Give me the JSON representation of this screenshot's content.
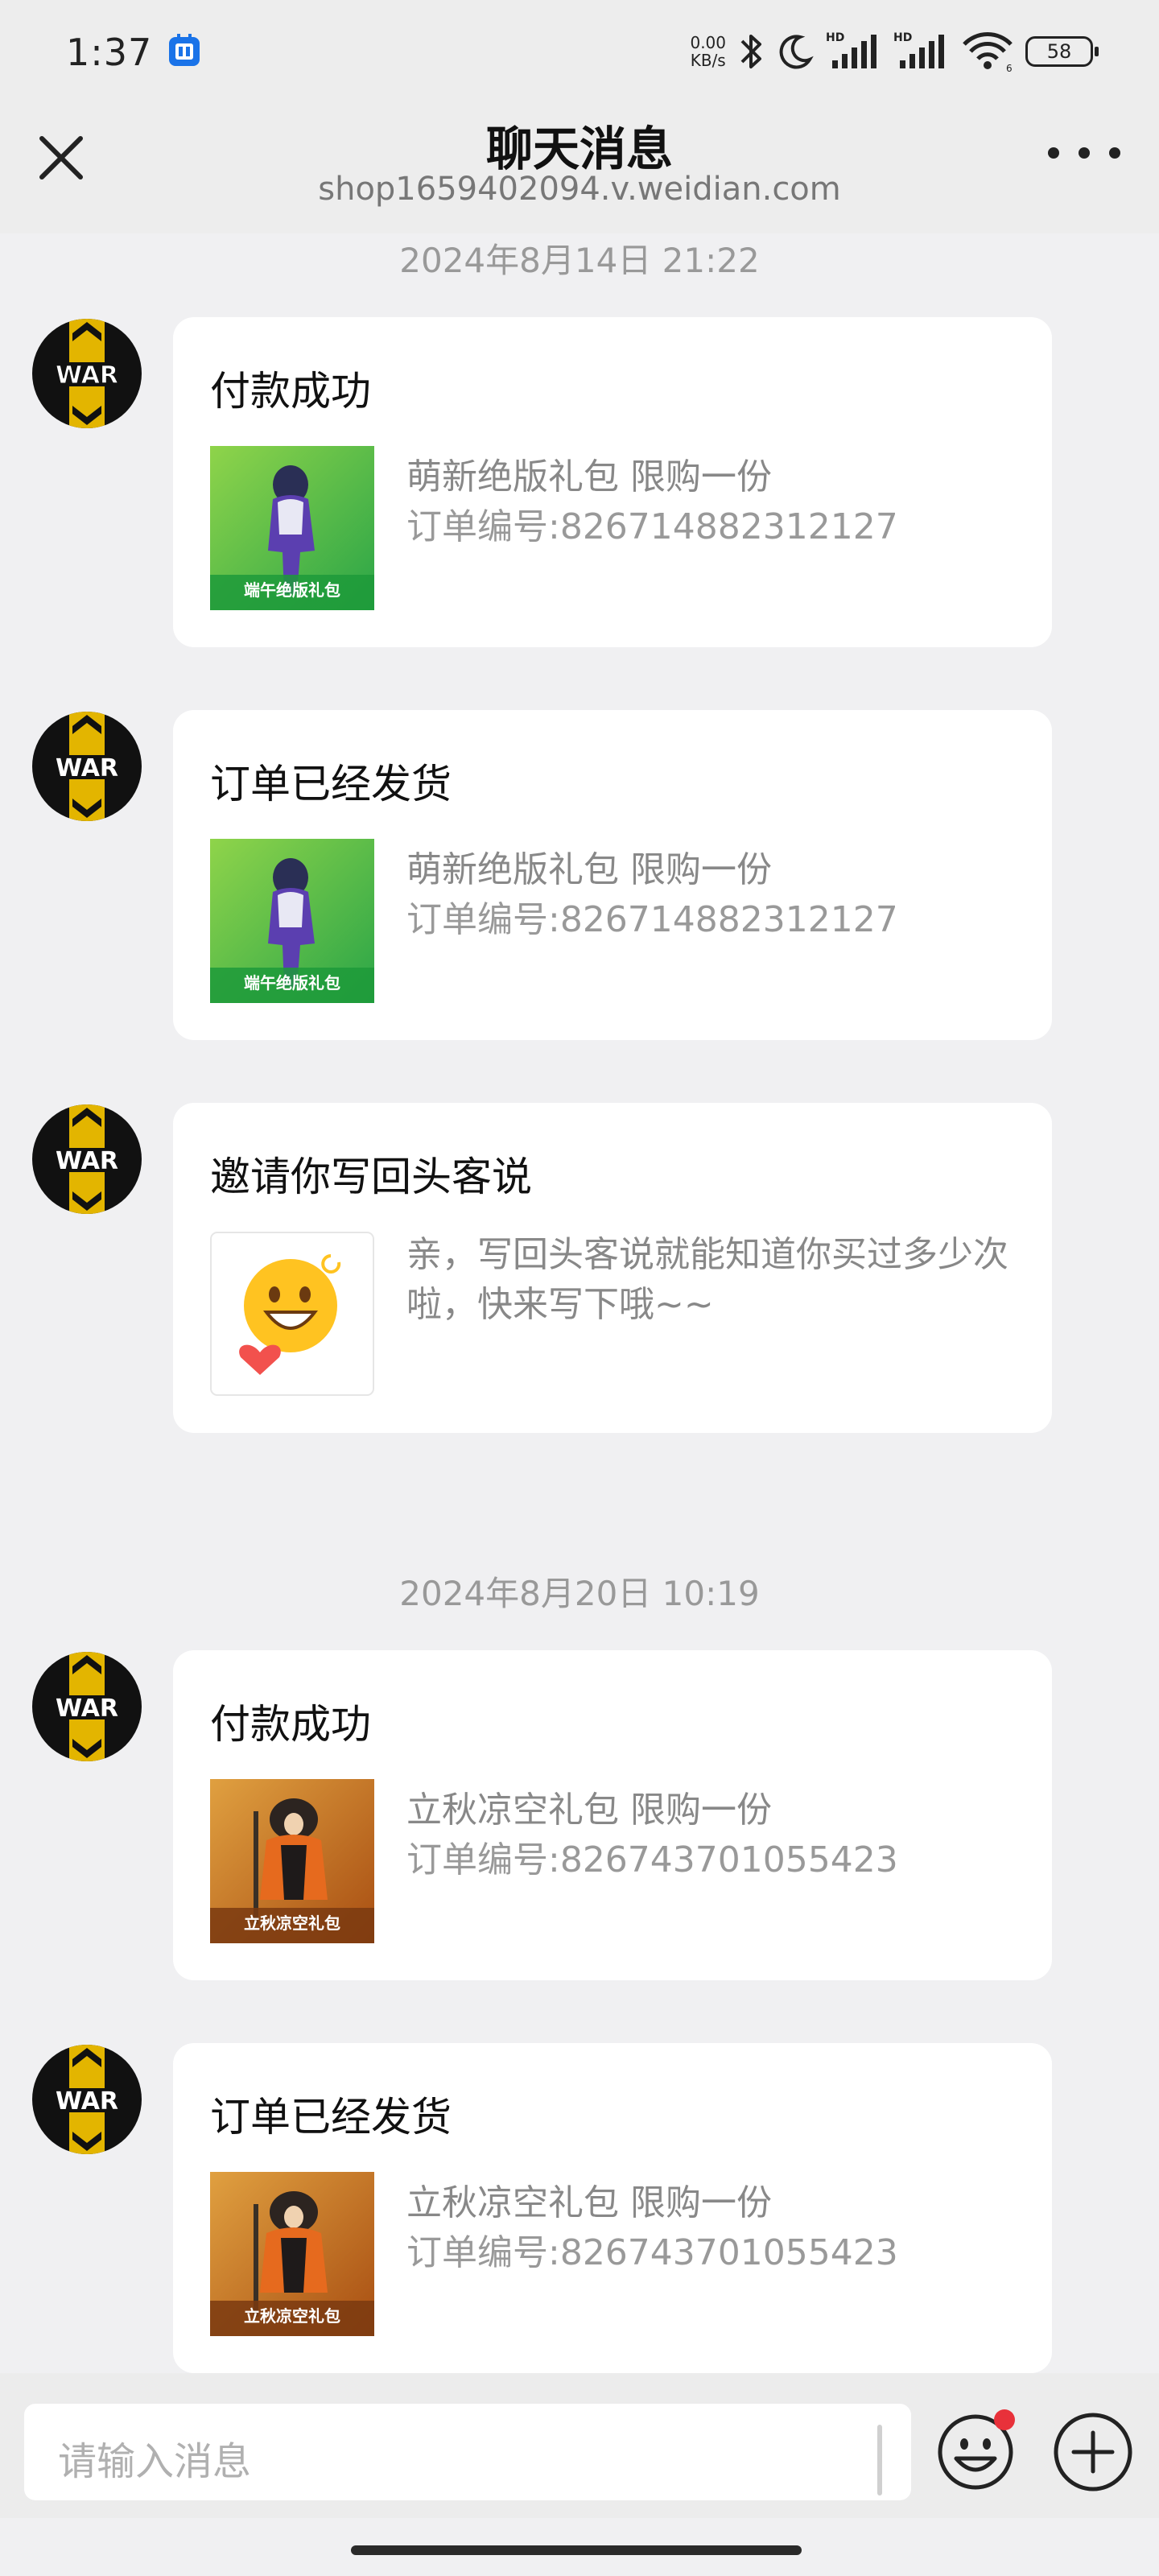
{
  "status_bar": {
    "time": "1:37",
    "net_speed_value": "0.00",
    "net_speed_unit": "KB/s",
    "icons": [
      "app-notification-icon",
      "bluetooth-icon",
      "do-not-disturb-moon-icon",
      "hd-signal-icon",
      "hd-signal-icon",
      "wifi-icon",
      "battery-icon"
    ],
    "battery": "58"
  },
  "header": {
    "title": "聊天消息",
    "subtitle": "shop1659402094.v.weidian.com",
    "close_icon": "close-icon",
    "more_icon": "more-dots-icon"
  },
  "messages": [
    {
      "timestamp": "2024年8月14日  21:22"
    },
    {
      "title": "付款成功",
      "thumb": "green",
      "product": "萌新绝版礼包  限购一份",
      "order": "订单编号:826714882312127"
    },
    {
      "title": "订单已经发货",
      "thumb": "green",
      "product": "萌新绝版礼包  限购一份",
      "order": "订单编号:826714882312127"
    },
    {
      "title": "邀请你写回头客说",
      "thumb": "smile",
      "text": "亲，写回头客说就能知道你买过多少次啦，快来写下哦~~"
    },
    {
      "timestamp": "2024年8月20日  10:19"
    },
    {
      "title": "付款成功",
      "thumb": "orange",
      "product": "立秋凉空礼包  限购一份",
      "order": "订单编号:826743701055423"
    },
    {
      "title": "订单已经发货",
      "thumb": "orange",
      "product": "立秋凉空礼包  限购一份",
      "order": "订单编号:826743701055423"
    }
  ],
  "input_bar": {
    "placeholder": "请输入消息",
    "emoji_icon": "emoji-icon",
    "plus_icon": "add-plus-icon"
  },
  "colors": {
    "background": "#f0f0f2",
    "card": "#ffffff",
    "emoji_badge": "#e8313a",
    "avatar_yellow": "#e3b500",
    "thumb_green": "#3fb24a",
    "thumb_orange": "#c86a18"
  }
}
